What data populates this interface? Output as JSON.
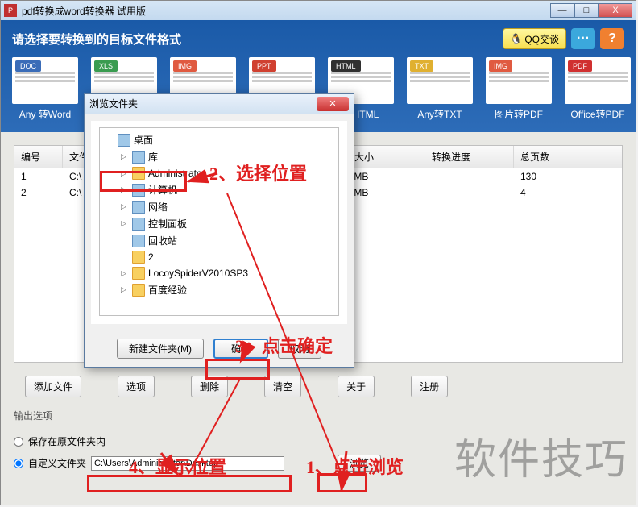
{
  "window": {
    "title": "pdf转换成word转换器 试用版",
    "min": "—",
    "max": "□",
    "close": "X"
  },
  "header": {
    "title": "请选择要转换到的目标文件格式",
    "qq_label": "QQ交谈",
    "chat_btn": "···",
    "help_btn": "?"
  },
  "formats": [
    {
      "badge": "DOC",
      "badge_class": "badge-doc",
      "label": "Any 转Word"
    },
    {
      "badge": "XLS",
      "badge_class": "badge-xls",
      "label": ""
    },
    {
      "badge": "IMG",
      "badge_class": "badge-img",
      "label": ""
    },
    {
      "badge": "PPT",
      "badge_class": "badge-ppt",
      "label": ""
    },
    {
      "badge": "HTML",
      "badge_class": "badge-html",
      "label": "转HTML"
    },
    {
      "badge": "TXT",
      "badge_class": "badge-txt",
      "label": "Any转TXT"
    },
    {
      "badge": "IMG",
      "badge_class": "badge-img",
      "label": "图片转PDF"
    },
    {
      "badge": "PDF",
      "badge_class": "badge-pdf",
      "label": "Office转PDF"
    }
  ],
  "table": {
    "headers": {
      "id": "编号",
      "file": "文件",
      "size": "文件大小",
      "progress": "转换进度",
      "pages": "总页数"
    },
    "rows": [
      {
        "id": "1",
        "file": "C:\\",
        "size": "0.64MB",
        "progress": "",
        "pages": "130"
      },
      {
        "id": "2",
        "file": "C:\\",
        "size": "0.04MB",
        "progress": "",
        "pages": "4"
      }
    ]
  },
  "toolbar": {
    "add": "添加文件",
    "options": "选项",
    "delete": "删除",
    "clear": "清空",
    "about": "关于",
    "register": "注册"
  },
  "output": {
    "title": "输出选项",
    "save_original": "保存在原文件夹内",
    "custom_folder": "自定义文件夹",
    "path": "C:\\Users\\Administrator\\Desktop",
    "browse": "浏览"
  },
  "modal": {
    "title": "浏览文件夹",
    "tree": [
      {
        "label": "桌面",
        "icon_class": "sys-icon",
        "arrow": "",
        "indent": false
      },
      {
        "label": "库",
        "icon_class": "sys-icon",
        "arrow": "▷",
        "indent": true
      },
      {
        "label": "Administrator",
        "icon_class": "folder-icon",
        "arrow": "▷",
        "indent": true
      },
      {
        "label": "计算机",
        "icon_class": "sys-icon",
        "arrow": "▷",
        "indent": true
      },
      {
        "label": "网络",
        "icon_class": "sys-icon",
        "arrow": "▷",
        "indent": true
      },
      {
        "label": "控制面板",
        "icon_class": "sys-icon",
        "arrow": "▷",
        "indent": true
      },
      {
        "label": "回收站",
        "icon_class": "sys-icon",
        "arrow": "",
        "indent": true
      },
      {
        "label": "2",
        "icon_class": "folder-icon",
        "arrow": "",
        "indent": true
      },
      {
        "label": "LocoySpiderV2010SP3",
        "icon_class": "folder-icon",
        "arrow": "▷",
        "indent": true
      },
      {
        "label": "百度经验",
        "icon_class": "folder-icon",
        "arrow": "▷",
        "indent": true
      }
    ],
    "new_folder": "新建文件夹(M)",
    "ok": "确定",
    "cancel": "取消"
  },
  "annotations": {
    "a1": "1、点击浏览",
    "a2": "2、选择位置",
    "a3": "3、点击确定",
    "a4": "4、显示位置",
    "watermark": "软件技巧"
  }
}
